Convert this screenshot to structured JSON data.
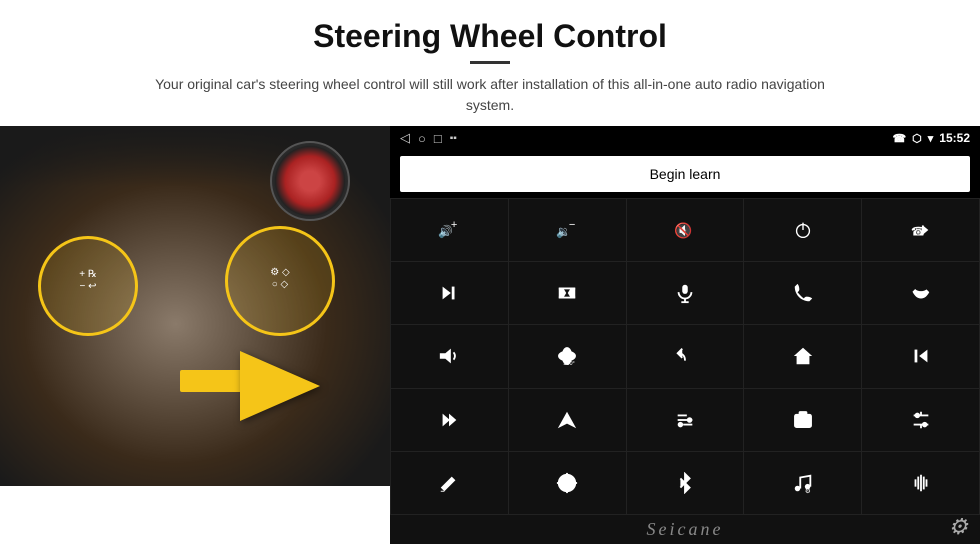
{
  "header": {
    "title": "Steering Wheel Control",
    "underline": true,
    "subtitle": "Your original car's steering wheel control will still work after installation of this all-in-one auto radio navigation system."
  },
  "statusBar": {
    "back": "◁",
    "home": "○",
    "square": "□",
    "signal": "▪▪",
    "phone": "☎",
    "location": "⬡",
    "wifi": "▼",
    "time": "15:52"
  },
  "beginLearn": {
    "label": "Begin learn"
  },
  "icons": [
    {
      "name": "vol-up",
      "symbol": "🔊+"
    },
    {
      "name": "vol-down",
      "symbol": "🔉-"
    },
    {
      "name": "mute",
      "symbol": "🔇"
    },
    {
      "name": "power",
      "symbol": "⏻"
    },
    {
      "name": "prev-track",
      "symbol": "⏮"
    },
    {
      "name": "skip-forward",
      "symbol": "⏭"
    },
    {
      "name": "shuffle",
      "symbol": "⇄"
    },
    {
      "name": "mic",
      "symbol": "🎤"
    },
    {
      "name": "phone",
      "symbol": "📞"
    },
    {
      "name": "hang-up",
      "symbol": "📵"
    },
    {
      "name": "horn",
      "symbol": "📣"
    },
    {
      "name": "camera-360",
      "symbol": "🔭"
    },
    {
      "name": "back",
      "symbol": "↩"
    },
    {
      "name": "home-btn",
      "symbol": "⌂"
    },
    {
      "name": "rewind-left",
      "symbol": "⏮"
    },
    {
      "name": "fast-forward",
      "symbol": "⏭"
    },
    {
      "name": "navigate",
      "symbol": "➤"
    },
    {
      "name": "eq",
      "symbol": "⇌"
    },
    {
      "name": "photo",
      "symbol": "📷"
    },
    {
      "name": "settings-sliders",
      "symbol": "🎛"
    },
    {
      "name": "pen",
      "symbol": "✏"
    },
    {
      "name": "target",
      "symbol": "🎯"
    },
    {
      "name": "bluetooth",
      "symbol": "⚡"
    },
    {
      "name": "music-settings",
      "symbol": "🎵"
    },
    {
      "name": "waveform",
      "symbol": "📊"
    }
  ],
  "brand": {
    "name": "Seicane"
  },
  "gear": "⚙"
}
